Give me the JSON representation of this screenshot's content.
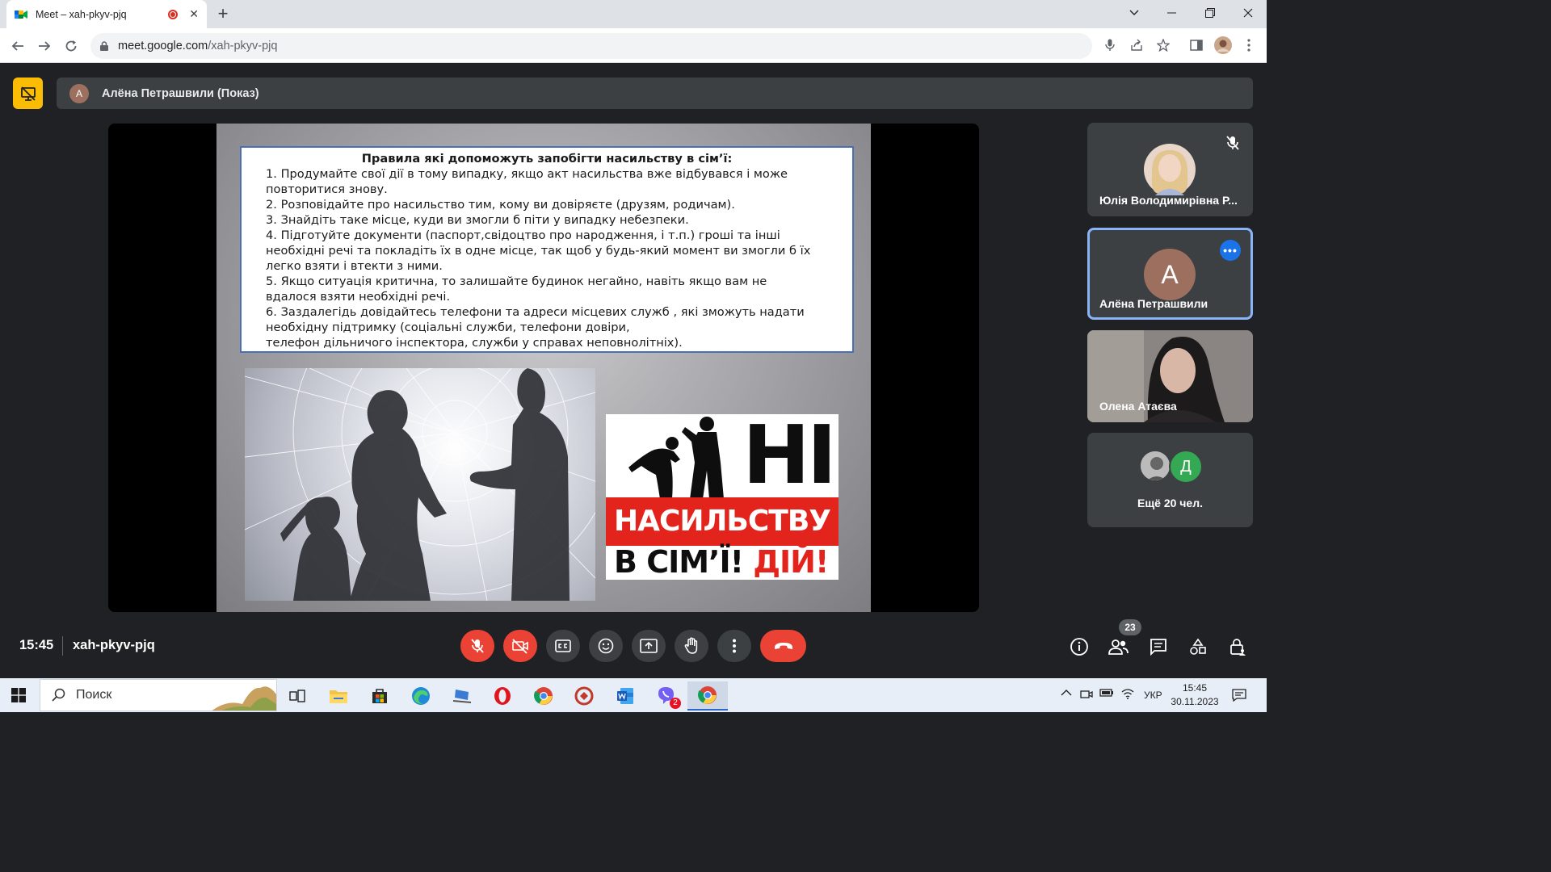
{
  "browser": {
    "tab_title": "Meet – xah-pkyv-pjq",
    "tab_close": "✕",
    "new_tab": "+",
    "url_host": "meet.google.com",
    "url_path": "/xah-pkyv-pjq"
  },
  "meet": {
    "presenter_initial": "А",
    "presenter_label": "Алёна Петрашвили (Показ)",
    "slide": {
      "title": "Правила які допоможуть запобігти насильству в сім’ї:",
      "lines": [
        "1. Продумайте свої дії в тому випадку, якщо акт насильства вже відбувався і може",
        "повторитися знову.",
        "2. Розповідайте про насильство тим, кому ви довіряєте (друзям, родичам).",
        "3. Знайдіть таке місце, куди ви змогли б піти у випадку небезпеки.",
        "4. Підготуйте документи (паспорт,свідоцтво про народження, і т.п.) гроші та інші",
        "необхідні речі та покладіть їх в одне місце, так щоб у будь-який момент ви змогли б їх",
        "легко взяти і втекти з ними.",
        "5. Якщо ситуація критична, то залишайте будинок негайно, навіть якщо вам не",
        "вдалося взяти необхідні речі.",
        "6. Заздалегідь довідайтесь телефони та адреси місцевих служб , які зможуть надати",
        "необхідну підтримку (соціальні служби, телефони довіри,",
        "телефон  дільничого  інспектора, служби у справах неповнолітніх)."
      ],
      "poster_ni": "НІ",
      "poster_band": "НАСИЛЬСТВУ",
      "poster_bottom": "В СІМ’Ї!",
      "poster_bottom_red": "ДІЙ!"
    },
    "participants": [
      {
        "name": "Юлія Володимирівна Р..."
      },
      {
        "name": "Алёна Петрашвили",
        "initial": "А"
      },
      {
        "name": "Олена Атаєва"
      },
      {
        "name": "Ещё 20 чел.",
        "initial": "Д"
      }
    ],
    "time": "15:45",
    "meeting_code": "xah-pkyv-pjq",
    "people_count": "23"
  },
  "taskbar": {
    "search_placeholder": "Поиск",
    "viber_badge": "2",
    "lang": "УКР",
    "time": "15:45",
    "date": "30.11.2023"
  },
  "colors": {
    "meet_bg": "#202124",
    "surface": "#3c4043",
    "end_call_red": "#ea4335",
    "present_yellow": "#fbbc04",
    "active_blue": "#8ab4f8"
  }
}
